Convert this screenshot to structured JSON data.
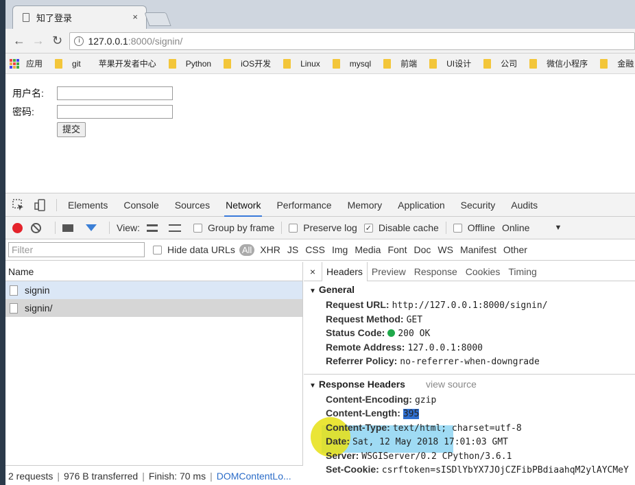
{
  "browser": {
    "tab_title": "知了登录",
    "tab_close": "×",
    "url_host": "127.0.0.1",
    "url_path": ":8000/signin/",
    "info_glyph": "i"
  },
  "bookmarks": [
    "应用",
    "git",
    "苹果开发者中心",
    "Python",
    "iOS开发",
    "Linux",
    "mysql",
    "前端",
    "UI设计",
    "公司",
    "微信小程序",
    "金融"
  ],
  "page": {
    "username_label": "用户名:",
    "password_label": "密码:",
    "submit_label": "提交"
  },
  "devtools": {
    "tabs": [
      "Elements",
      "Console",
      "Sources",
      "Network",
      "Performance",
      "Memory",
      "Application",
      "Security",
      "Audits"
    ],
    "active_tab": "Network",
    "toolbar": {
      "view_label": "View:",
      "group_by_frame": "Group by frame",
      "preserve_log": "Preserve log",
      "disable_cache": "Disable cache",
      "offline": "Offline",
      "online": "Online",
      "caret": "▼"
    },
    "filter": {
      "placeholder": "Filter",
      "hide_data_urls": "Hide data URLs",
      "all": "All",
      "types": [
        "XHR",
        "JS",
        "CSS",
        "Img",
        "Media",
        "Font",
        "Doc",
        "WS",
        "Manifest",
        "Other"
      ]
    },
    "requests_header": "Name",
    "requests": [
      "signin",
      "signin/"
    ],
    "status": {
      "requests": "2 requests",
      "transferred": "976 B transferred",
      "finish": "Finish: 70 ms",
      "dom": "DOMContentLo..."
    },
    "detail_tabs": [
      "Headers",
      "Preview",
      "Response",
      "Cookies",
      "Timing"
    ],
    "detail_close": "×",
    "general": {
      "title": "General",
      "tri": "▼",
      "rows": [
        {
          "k": "Request URL:",
          "v": "http://127.0.0.1:8000/signin/"
        },
        {
          "k": "Request Method:",
          "v": "GET"
        },
        {
          "k": "Status Code:",
          "v": "200 OK"
        },
        {
          "k": "Remote Address:",
          "v": "127.0.0.1:8000"
        },
        {
          "k": "Referrer Policy:",
          "v": "no-referrer-when-downgrade"
        }
      ]
    },
    "response_headers": {
      "title": "Response Headers",
      "tri": "▼",
      "view_source": "view source",
      "rows": [
        {
          "k": "Content-Encoding:",
          "v": "gzip"
        },
        {
          "k": "Content-Length:",
          "v": "395"
        },
        {
          "k": "Content-Type:",
          "v": "text/html; charset=utf-8"
        },
        {
          "k": "Date:",
          "v": "Sat, 12 May 2018 17:01:03 GMT"
        },
        {
          "k": "Server:",
          "v": "WSGIServer/0.2 CPython/3.6.1"
        },
        {
          "k": "Set-Cookie:",
          "v": "csrftoken=sISDlYbYX7JOjCZFibPBdiaahqM2ylAYCMeY"
        }
      ]
    }
  },
  "colors": {
    "record": "#e4232b",
    "accent": "#3879d9",
    "status_ok": "#1fa84a",
    "folder": "#f3c63a"
  }
}
